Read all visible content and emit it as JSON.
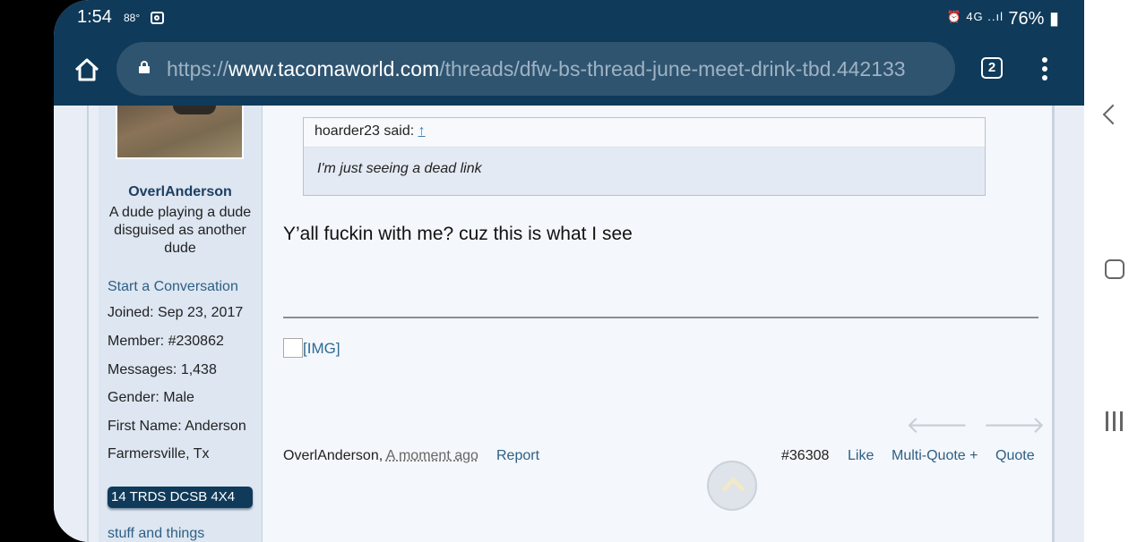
{
  "status_bar": {
    "time": "1:54",
    "temperature": "88°",
    "indicators": "⏰ 4G ..ıl",
    "battery": "76%"
  },
  "browser": {
    "url_prefix": "https://",
    "url_host": "www.tacomaworld.com",
    "url_path": "/threads/dfw-bs-thread-june-meet-drink-tbd.442133",
    "tab_count": "2"
  },
  "sidebar": {
    "username": "OverlAnderson",
    "user_title": "A dude playing a dude disguised as another dude",
    "start_conversation": "Start a Conversation",
    "joined": "Joined:  Sep 23, 2017",
    "member": "Member:  #230862",
    "messages": "Messages:  1,438",
    "gender": "Gender:  Male",
    "first_name": "First Name:  Anderson",
    "location": "Farmersville, Tx",
    "vehicle": "14 TRDS DCSB 4X4",
    "extra_link": "stuff and things"
  },
  "post": {
    "quote_author": "hoarder23 said:",
    "quote_arrow": "↑",
    "quote_text": "I'm just seeing a dead link",
    "message": "Y’all fuckin with me? cuz this is what I see",
    "image_alt": "[IMG]",
    "author": "OverlAnderson,",
    "time": "A moment ago",
    "report": "Report",
    "post_number": "#36308",
    "like": "Like",
    "multi_quote": "Multi-Quote +",
    "quote": "Quote"
  }
}
